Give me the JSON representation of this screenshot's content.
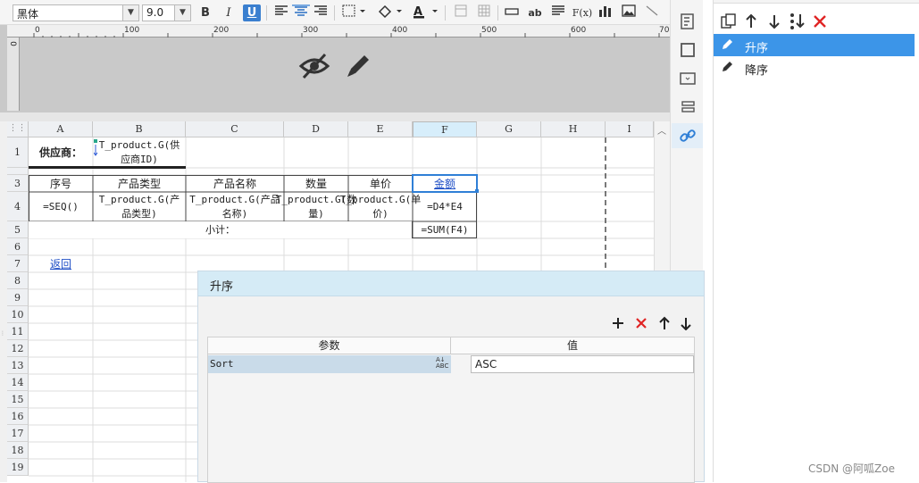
{
  "toolbar": {
    "font_family": "黑体",
    "font_size": "9.0",
    "bold": "B",
    "italic": "I",
    "underline": "U",
    "text_label_ab": "ab",
    "formula_label": "F(x)"
  },
  "ruler": {
    "ticks": [
      "0",
      "100",
      "200",
      "300",
      "400",
      "500",
      "600",
      "70"
    ],
    "side_tick": "0"
  },
  "grid": {
    "columns": [
      "A",
      "B",
      "C",
      "D",
      "E",
      "F",
      "G",
      "H",
      "I"
    ],
    "rows": [
      "1",
      "3",
      "4",
      "5",
      "6",
      "7",
      "8",
      "9",
      "10",
      "11",
      "12",
      "13",
      "14",
      "15",
      "16",
      "17",
      "18",
      "19"
    ],
    "cells": {
      "a1": "供应商：",
      "b1": "T_product.G(供应商ID)",
      "a3": "序号",
      "b3": "产品类型",
      "c3": "产品名称",
      "d3": "数量",
      "e3": "单价",
      "f3": "金额",
      "a4": "=SEQ()",
      "b4": "T_product.G(产品类型)",
      "c4": "T_product.G(产品名称)",
      "d4": "T_product.G(数量)",
      "e4": "T_product.G(单价)",
      "f4": "=D4*E4",
      "a5": "小计：",
      "f5": "=SUM(F4)",
      "a7": "返回"
    }
  },
  "right_panel": {
    "items": [
      {
        "label": "升序",
        "selected": true
      },
      {
        "label": "降序",
        "selected": false
      }
    ]
  },
  "dialog": {
    "title": "升序",
    "table_headers": [
      "参数",
      "值"
    ],
    "rows": [
      {
        "param": "Sort",
        "value": "ASC"
      }
    ]
  },
  "watermark": "CSDN @阿呱Zoe",
  "colors": {
    "accent": "#3c95e8",
    "delete": "#e02424",
    "selected_col": "#d7eefb",
    "dialog_title_bg": "#d5ebf6"
  }
}
